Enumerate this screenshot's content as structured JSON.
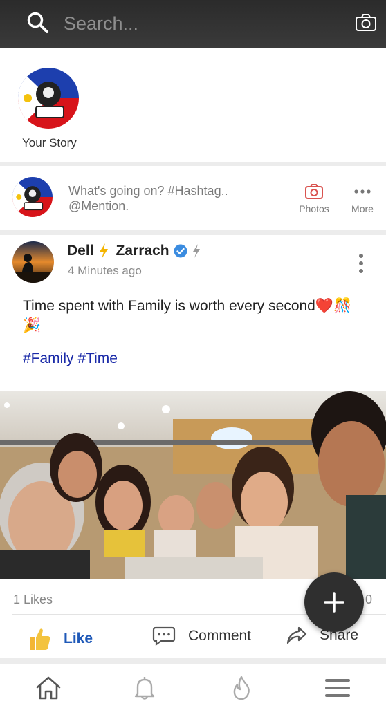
{
  "search": {
    "placeholder": "Search..."
  },
  "stories": {
    "your_story_label": "Your Story"
  },
  "composer": {
    "placeholder": "What's going on? #Hashtag.. @Mention.",
    "photos_label": "Photos",
    "more_label": "More"
  },
  "post": {
    "author_first": "Dell",
    "author_last": "Zarrach",
    "time": "4 Minutes ago",
    "text": "Time spent with Family is worth every second❤️🎊🎉",
    "tags": "#Family #Time",
    "likes": "1 Likes",
    "comments_count": "0",
    "like_label": "Like",
    "comment_label": "Comment",
    "share_label": "Share"
  },
  "colors": {
    "accent": "#1f59b8",
    "hashtag": "#1a2aa8",
    "topbar": "#333333",
    "photo_icon": "#d9534f"
  },
  "icons": [
    "search-icon",
    "camera-icon",
    "photos-icon",
    "more-icon",
    "verified-icon",
    "lightning-icon",
    "kebab-menu-icon",
    "thumbs-up-icon",
    "comment-icon",
    "share-icon",
    "plus-icon",
    "home-icon",
    "bell-icon",
    "fire-icon",
    "hamburger-icon"
  ]
}
